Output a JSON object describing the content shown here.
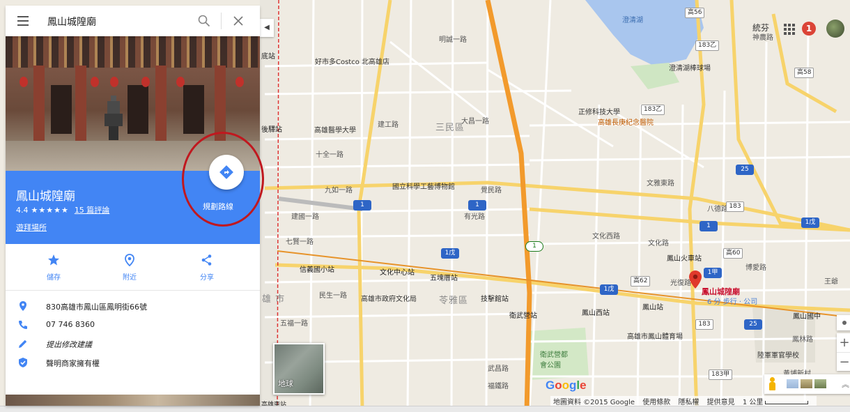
{
  "search": {
    "value": "鳳山城隍廟"
  },
  "place": {
    "name": "鳳山城隍廟",
    "rating": "4.4",
    "stars": "★★★★★",
    "reviews": "15 篇評論",
    "claim": "遊拜場所",
    "directions_label": "規劃路線"
  },
  "actions": [
    {
      "label": "儲存",
      "icon": "star-icon"
    },
    {
      "label": "附近",
      "icon": "nearby-icon"
    },
    {
      "label": "分享",
      "icon": "share-icon"
    }
  ],
  "info": {
    "address": "830高雄市鳳山區鳳明街66號",
    "phone": "07 746 8360",
    "suggest_edit": "提出修改建議",
    "claim_business": "聲明商家擁有權"
  },
  "map": {
    "earth_label": "地球",
    "notification_count": "1",
    "google": [
      "G",
      "o",
      "o",
      "g",
      "l",
      "e"
    ],
    "google_colors": [
      "#4285f4",
      "#ea4335",
      "#fbbc05",
      "#4285f4",
      "#34a853",
      "#ea4335"
    ],
    "attribution": {
      "data": "地圖資料 ©2015 Google",
      "terms": "使用條款",
      "privacy": "隱私權",
      "feedback": "提供意見",
      "scale": "1 公里"
    },
    "pin": {
      "name": "鳳山城隍廟",
      "walk": "6 分 步行 · 公司"
    },
    "districts": [
      {
        "text": "三民區"
      },
      {
        "text": "苓雅區"
      },
      {
        "text": "雄 市"
      }
    ],
    "labels": [
      {
        "text": "好市多Costco 北高雄店"
      },
      {
        "text": "高雄醫學大學"
      },
      {
        "text": "國立科學工藝博物館"
      },
      {
        "text": "正修科技大學"
      },
      {
        "text": "高雄長庚紀念醫院"
      },
      {
        "text": "澄清湖棒球場"
      },
      {
        "text": "澄清湖"
      },
      {
        "text": "鳳山火車站"
      },
      {
        "text": "高雄市鳳山體育場"
      },
      {
        "text": "陸軍軍官學校"
      },
      {
        "text": "衛武營都會公園"
      },
      {
        "text": "高雄市政府文化局"
      },
      {
        "text": "文化西路"
      },
      {
        "text": "九如一路"
      },
      {
        "text": "建國一路"
      },
      {
        "text": "七賢一路"
      },
      {
        "text": "民生一路"
      },
      {
        "text": "五福一路"
      },
      {
        "text": "有光路"
      },
      {
        "text": "八德路"
      },
      {
        "text": "光復路"
      },
      {
        "text": "文化路"
      },
      {
        "text": "博愛路"
      },
      {
        "text": "建工路"
      },
      {
        "text": "大昌一路"
      },
      {
        "text": "覺民路"
      },
      {
        "text": "文雅東路"
      },
      {
        "text": "十全一路"
      },
      {
        "text": "明誠一路"
      },
      {
        "text": "鳳林路"
      },
      {
        "text": "黃埔新村"
      },
      {
        "text": "統芬"
      },
      {
        "text": "神農路"
      },
      {
        "text": "王爺"
      },
      {
        "text": "武昌路"
      },
      {
        "text": "福鐵路"
      }
    ],
    "metro": [
      {
        "text": "文化中心站"
      },
      {
        "text": "五塊厝站"
      },
      {
        "text": "技擊館站"
      },
      {
        "text": "衛武營站"
      },
      {
        "text": "鳳山西站"
      },
      {
        "text": "鳳山站"
      },
      {
        "text": "鳳山國中"
      },
      {
        "text": "信義國小站"
      },
      {
        "text": "高雄車站"
      },
      {
        "text": "後驛站"
      },
      {
        "text": "底站"
      }
    ],
    "routes": [
      {
        "text": "1",
        "style": "blue"
      },
      {
        "text": "1",
        "style": "blue"
      },
      {
        "text": "1",
        "style": "blue"
      },
      {
        "text": "1戊",
        "style": "blue"
      },
      {
        "text": "1戊",
        "style": "blue"
      },
      {
        "text": "1戊",
        "style": "blue"
      },
      {
        "text": "1甲",
        "style": "blue"
      },
      {
        "text": "1",
        "style": "green"
      },
      {
        "text": "25",
        "style": "blue"
      },
      {
        "text": "25",
        "style": "blue"
      },
      {
        "text": "183乙",
        "style": "white"
      },
      {
        "text": "183乙",
        "style": "white"
      },
      {
        "text": "183",
        "style": "white"
      },
      {
        "text": "183",
        "style": "white"
      },
      {
        "text": "183甲",
        "style": "white"
      },
      {
        "text": "高56",
        "style": "white"
      },
      {
        "text": "高58",
        "style": "white"
      },
      {
        "text": "高60",
        "style": "white"
      },
      {
        "text": "高62",
        "style": "white"
      }
    ]
  }
}
